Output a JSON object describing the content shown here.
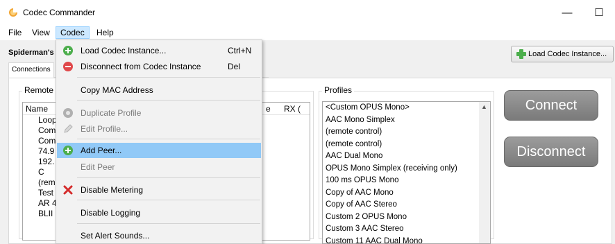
{
  "window": {
    "title": "Codec Commander",
    "minimize": "—",
    "maximize": "☐",
    "close": "✕"
  },
  "menubar": {
    "file": "File",
    "view": "View",
    "codec": "Codec",
    "help": "Help"
  },
  "instance": {
    "title": "Spiderman's",
    "load_button": "Load Codec Instance..."
  },
  "tabs": {
    "connections": "Connections"
  },
  "remote": {
    "label": "Remote",
    "headers": {
      "name": "Name",
      "col_e": "e",
      "rx": "RX ("
    },
    "rows": [
      "Loop",
      "Com",
      "Com",
      "74.9",
      "192.",
      "C",
      "(rem",
      "Test",
      "AR 4",
      "BLII"
    ]
  },
  "profiles": {
    "label": "Profiles",
    "items": [
      "<Custom OPUS Mono>",
      "AAC Mono Simplex",
      "(remote control)",
      "(remote control)",
      "AAC Dual Mono",
      "OPUS Mono Simplex (receiving only)",
      "100 ms OPUS Mono",
      "Copy of AAC Mono",
      "Copy of AAC Stereo",
      "Custom 2 OPUS Mono",
      "Custom 3 AAC Stereo",
      "Custom 11 AAC Dual Mono"
    ]
  },
  "buttons": {
    "connect": "Connect",
    "disconnect": "Disconnect"
  },
  "codec_menu": {
    "load": {
      "label": "Load Codec Instance...",
      "shortcut": "Ctrl+N"
    },
    "disconnect": {
      "label": "Disconnect from Codec Instance",
      "shortcut": "Del"
    },
    "copy_mac": {
      "label": "Copy MAC Address"
    },
    "duplicate": {
      "label": "Duplicate Profile"
    },
    "edit_profile": {
      "label": "Edit Profile..."
    },
    "add_peer": {
      "label": "Add Peer..."
    },
    "edit_peer": {
      "label": "Edit Peer"
    },
    "disable_metering": {
      "label": "Disable Metering"
    },
    "disable_logging": {
      "label": "Disable Logging"
    },
    "alert_sounds": {
      "label": "Set Alert Sounds..."
    }
  },
  "colors": {
    "menu_highlight": "#91c9f7",
    "big_button": "#8a8a8a",
    "green_icon": "#4cae4c",
    "red_icon": "#e0484a"
  }
}
